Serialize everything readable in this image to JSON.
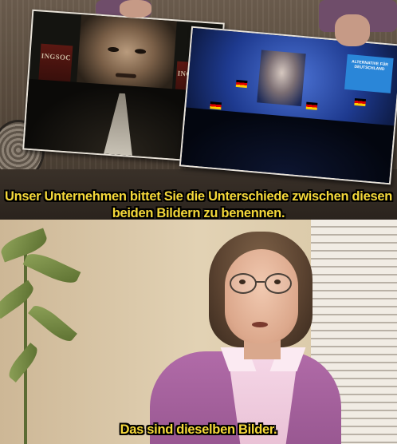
{
  "top_panel": {
    "left_photo": {
      "banner_left_text": "INGSOC",
      "banner_right_text": "INGSOC"
    },
    "right_photo": {
      "logo_text": "ALTERNATIVE FÜR DEUTSCHLAND"
    },
    "caption": "Unser Unternehmen bittet Sie die Unterschiede zwischen diesen beiden Bildern zu benennen."
  },
  "bottom_panel": {
    "caption": "Das sind dieselben Bilder."
  },
  "colors": {
    "caption_text": "#f4d83a",
    "caption_outline": "#000000",
    "cardigan": "#b16ba8"
  }
}
